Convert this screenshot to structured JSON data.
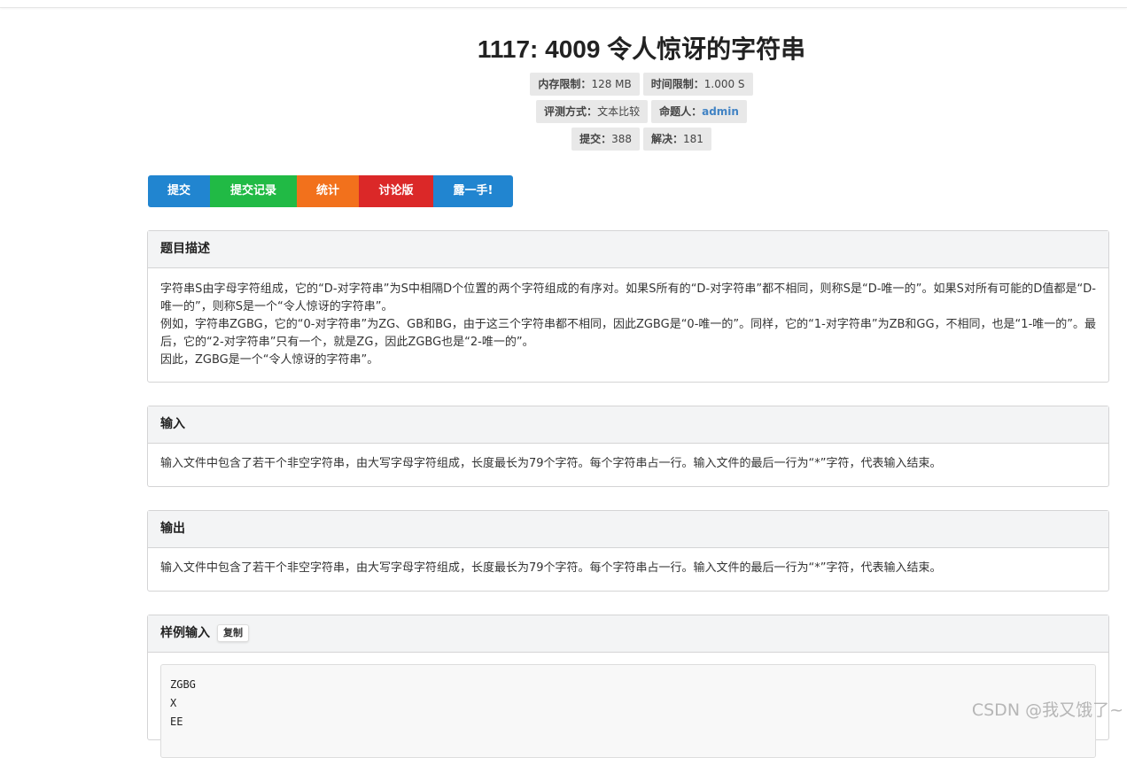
{
  "problem": {
    "title": "1117: 4009 令人惊讶的字符串"
  },
  "meta": {
    "memory_label": "内存限制：",
    "memory_value": "128 MB",
    "time_label": "时间限制：",
    "time_value": "1.000 S",
    "judge_label": "评测方式：",
    "judge_value": "文本比较",
    "author_label": "命题人：",
    "author_value": "admin",
    "submit_label": "提交：",
    "submit_value": "388",
    "solved_label": "解决：",
    "solved_value": "181"
  },
  "actions": {
    "submit": "提交",
    "records": "提交记录",
    "stats": "统计",
    "discuss": "讨论版",
    "show_off": "露一手!"
  },
  "colors": {
    "submit": "#2185d0",
    "records": "#21ba45",
    "stats": "#f2711c",
    "discuss": "#db2828",
    "show_off": "#2185d0"
  },
  "description": {
    "heading": "题目描述",
    "para1": "字符串S由字母字符组成，它的“D-对字符串”为S中相隔D个位置的两个字符组成的有序对。如果S所有的“D-对字符串”都不相同，则称S是“D-唯一的”。如果S对所有可能的D值都是“D-唯一的”，则称S是一个“令人惊讶的字符串”。",
    "para2": "例如，字符串ZGBG，它的“0-对字符串”为ZG、GB和BG，由于这三个字符串都不相同，因此ZGBG是“0-唯一的”。同样，它的“1-对字符串”为ZB和GG，不相同，也是“1-唯一的”。最后，它的“2-对字符串”只有一个，就是ZG，因此ZGBG也是“2-唯一的”。",
    "para3": "因此，ZGBG是一个“令人惊讶的字符串”。"
  },
  "input": {
    "heading": "输入",
    "text": "输入文件中包含了若干个非空字符串，由大写字母字符组成，长度最长为79个字符。每个字符串占一行。输入文件的最后一行为“*”字符，代表输入结束。"
  },
  "output": {
    "heading": "输出",
    "text": "输入文件中包含了若干个非空字符串，由大写字母字符组成，长度最长为79个字符。每个字符串占一行。输入文件的最后一行为“*”字符，代表输入结束。"
  },
  "sample_input": {
    "heading": "样例输入",
    "copy_label": "复制",
    "lines": [
      "ZGBG",
      "X",
      "EE"
    ]
  },
  "watermark": "CSDN @我又饿了~"
}
